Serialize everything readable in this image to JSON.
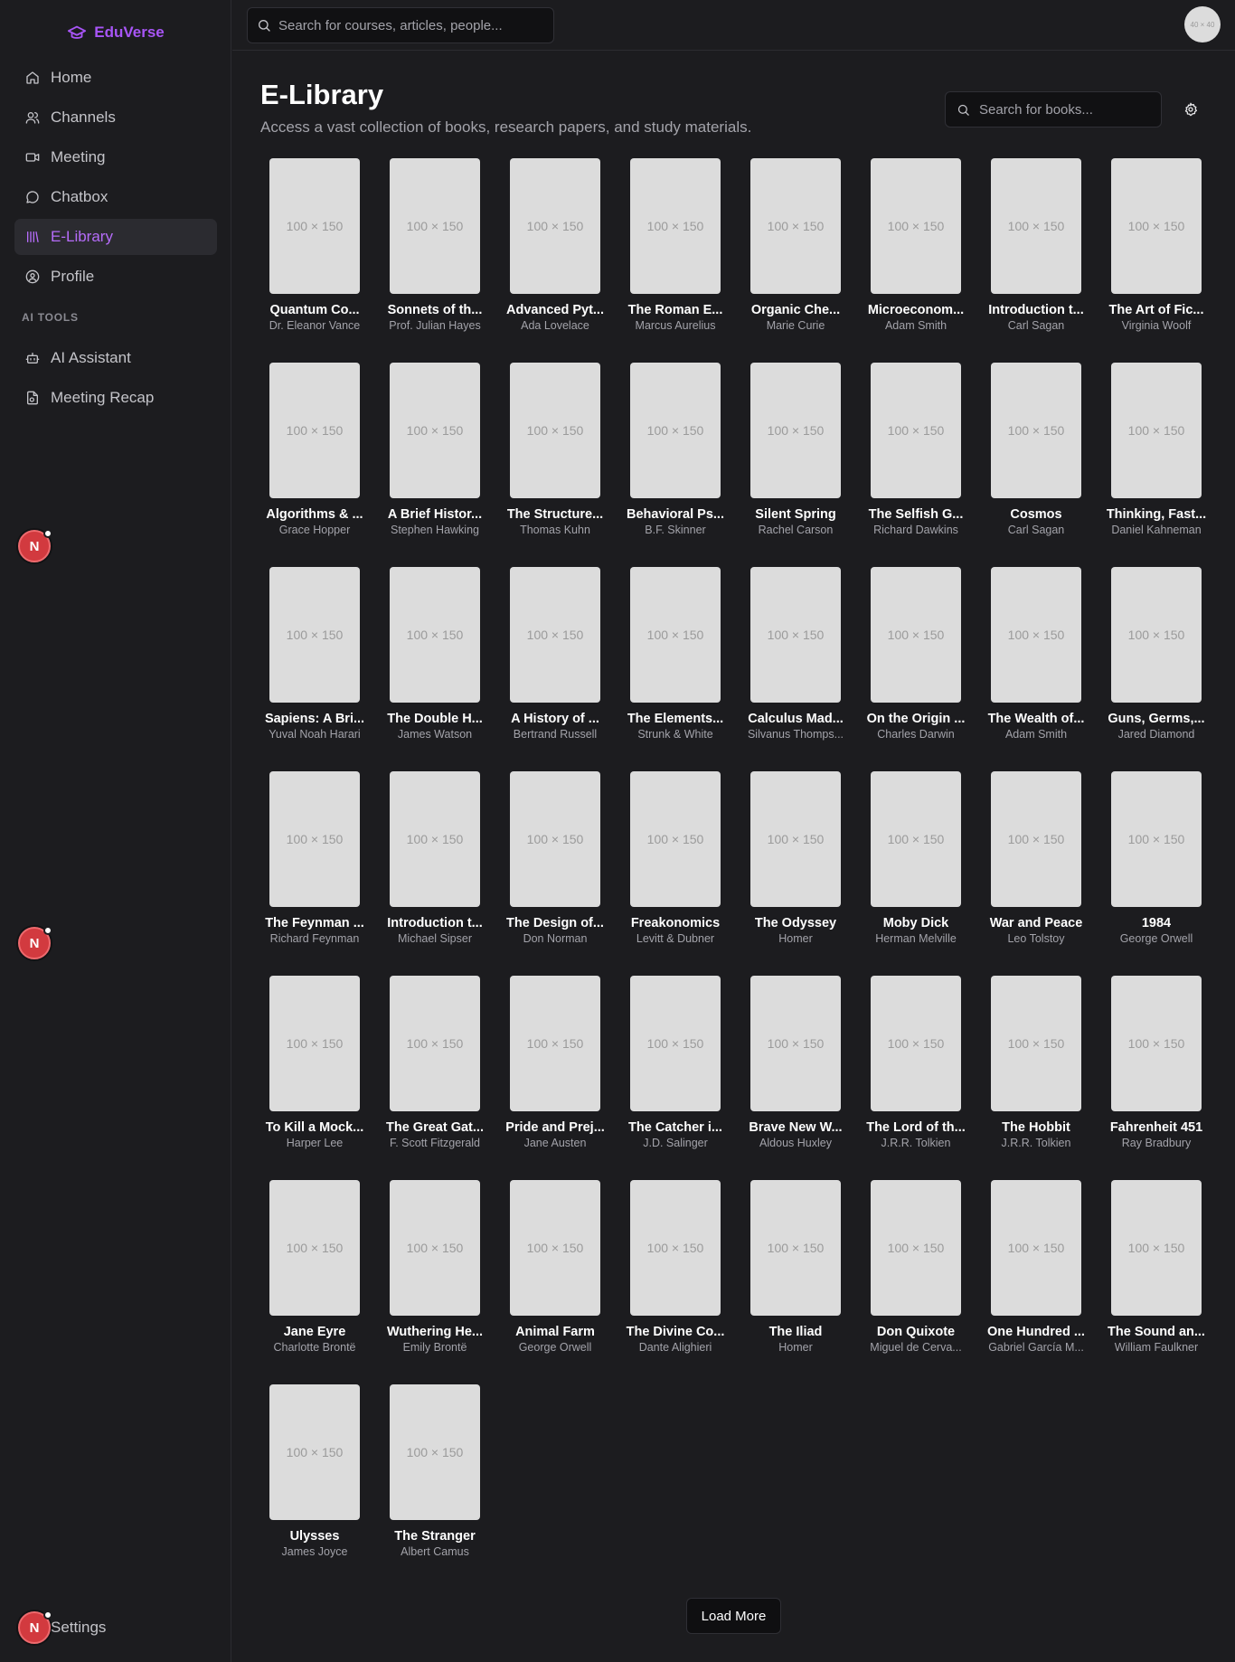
{
  "brand": {
    "name": "EduVerse",
    "icon": "graduation-cap-icon",
    "accent": "#a855f7"
  },
  "sidebar": {
    "items": [
      {
        "label": "Home",
        "icon": "home-icon",
        "active": false
      },
      {
        "label": "Channels",
        "icon": "users-icon",
        "active": false
      },
      {
        "label": "Meeting",
        "icon": "video-icon",
        "active": false
      },
      {
        "label": "Chatbox",
        "icon": "chat-bubble-icon",
        "active": false
      },
      {
        "label": "E-Library",
        "icon": "library-icon",
        "active": true
      },
      {
        "label": "Profile",
        "icon": "user-circle-icon",
        "active": false
      }
    ],
    "section_label": "AI TOOLS",
    "ai_items": [
      {
        "label": "AI Assistant",
        "icon": "bot-icon"
      },
      {
        "label": "Meeting Recap",
        "icon": "recap-file-icon"
      }
    ],
    "settings_label": "Settings",
    "badge_letter": "N"
  },
  "topbar": {
    "search_placeholder": "Search for courses, articles, people...",
    "avatar_text": "40 × 40"
  },
  "page": {
    "title": "E-Library",
    "subtitle": "Access a vast collection of books, research papers, and study materials.",
    "search_placeholder": "Search for books...",
    "cover_placeholder": "100 × 150",
    "load_more_label": "Load More"
  },
  "books": [
    {
      "title": "Quantum Co...",
      "author": "Dr. Eleanor Vance"
    },
    {
      "title": "Sonnets of th...",
      "author": "Prof. Julian Hayes"
    },
    {
      "title": "Advanced Pyt...",
      "author": "Ada Lovelace"
    },
    {
      "title": "The Roman E...",
      "author": "Marcus Aurelius"
    },
    {
      "title": "Organic Che...",
      "author": "Marie Curie"
    },
    {
      "title": "Microeconom...",
      "author": "Adam Smith"
    },
    {
      "title": "Introduction t...",
      "author": "Carl Sagan"
    },
    {
      "title": "The Art of Fic...",
      "author": "Virginia Woolf"
    },
    {
      "title": "Algorithms & ...",
      "author": "Grace Hopper"
    },
    {
      "title": "A Brief Histor...",
      "author": "Stephen Hawking"
    },
    {
      "title": "The Structure...",
      "author": "Thomas Kuhn"
    },
    {
      "title": "Behavioral Ps...",
      "author": "B.F. Skinner"
    },
    {
      "title": "Silent Spring",
      "author": "Rachel Carson"
    },
    {
      "title": "The Selfish G...",
      "author": "Richard Dawkins"
    },
    {
      "title": "Cosmos",
      "author": "Carl Sagan"
    },
    {
      "title": "Thinking, Fast...",
      "author": "Daniel Kahneman"
    },
    {
      "title": "Sapiens: A Bri...",
      "author": "Yuval Noah Harari"
    },
    {
      "title": "The Double H...",
      "author": "James Watson"
    },
    {
      "title": "A History of ...",
      "author": "Bertrand Russell"
    },
    {
      "title": "The Elements...",
      "author": "Strunk & White"
    },
    {
      "title": "Calculus Mad...",
      "author": "Silvanus Thomps..."
    },
    {
      "title": "On the Origin ...",
      "author": "Charles Darwin"
    },
    {
      "title": "The Wealth of...",
      "author": "Adam Smith"
    },
    {
      "title": "Guns, Germs,...",
      "author": "Jared Diamond"
    },
    {
      "title": "The Feynman ...",
      "author": "Richard Feynman"
    },
    {
      "title": "Introduction t...",
      "author": "Michael Sipser"
    },
    {
      "title": "The Design of...",
      "author": "Don Norman"
    },
    {
      "title": "Freakonomics",
      "author": "Levitt & Dubner"
    },
    {
      "title": "The Odyssey",
      "author": "Homer"
    },
    {
      "title": "Moby Dick",
      "author": "Herman Melville"
    },
    {
      "title": "War and Peace",
      "author": "Leo Tolstoy"
    },
    {
      "title": "1984",
      "author": "George Orwell"
    },
    {
      "title": "To Kill a Mock...",
      "author": "Harper Lee"
    },
    {
      "title": "The Great Gat...",
      "author": "F. Scott Fitzgerald"
    },
    {
      "title": "Pride and Prej...",
      "author": "Jane Austen"
    },
    {
      "title": "The Catcher i...",
      "author": "J.D. Salinger"
    },
    {
      "title": "Brave New W...",
      "author": "Aldous Huxley"
    },
    {
      "title": "The Lord of th...",
      "author": "J.R.R. Tolkien"
    },
    {
      "title": "The Hobbit",
      "author": "J.R.R. Tolkien"
    },
    {
      "title": "Fahrenheit 451",
      "author": "Ray Bradbury"
    },
    {
      "title": "Jane Eyre",
      "author": "Charlotte Brontë"
    },
    {
      "title": "Wuthering He...",
      "author": "Emily Brontë"
    },
    {
      "title": "Animal Farm",
      "author": "George Orwell"
    },
    {
      "title": "The Divine Co...",
      "author": "Dante Alighieri"
    },
    {
      "title": "The Iliad",
      "author": "Homer"
    },
    {
      "title": "Don Quixote",
      "author": "Miguel de Cerva..."
    },
    {
      "title": "One Hundred ...",
      "author": "Gabriel García M..."
    },
    {
      "title": "The Sound an...",
      "author": "William Faulkner"
    },
    {
      "title": "Ulysses",
      "author": "James Joyce"
    },
    {
      "title": "The Stranger",
      "author": "Albert Camus"
    }
  ]
}
